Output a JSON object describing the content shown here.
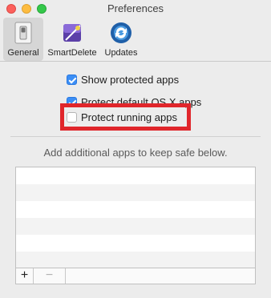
{
  "window": {
    "title": "Preferences",
    "controls": [
      "close",
      "minimize",
      "zoom"
    ]
  },
  "toolbar": {
    "items": [
      {
        "label": "General",
        "icon": "switch-icon",
        "selected": true
      },
      {
        "label": "SmartDelete",
        "icon": "smartdelete-icon",
        "selected": false
      },
      {
        "label": "Updates",
        "icon": "updates-icon",
        "selected": false
      }
    ]
  },
  "options": [
    {
      "label": "Show protected apps",
      "checked": true
    },
    {
      "label": "Protect default OS X apps",
      "checked": true
    },
    {
      "label": "Protect running apps",
      "checked": false
    }
  ],
  "apps_list": {
    "hint": "Add additional apps to keep safe below.",
    "items": [],
    "add_label": "+",
    "remove_label": "−"
  },
  "colors": {
    "highlight": "#e0262b",
    "checkbox_on": "#3b8ef5"
  }
}
